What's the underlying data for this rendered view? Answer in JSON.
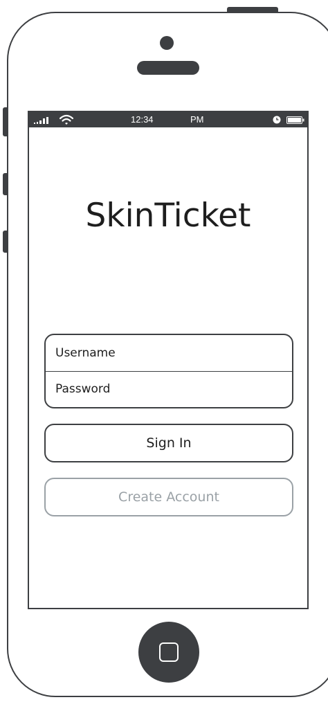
{
  "statusbar": {
    "time": "12:34",
    "ampm": "PM",
    "signal_icon": "signal-bars-icon",
    "wifi_icon": "wifi-icon",
    "clock_icon": "clock-icon",
    "battery_icon": "battery-icon"
  },
  "app": {
    "title": "SkinTicket"
  },
  "login_form": {
    "username_placeholder": "Username",
    "password_placeholder": "Password",
    "username_value": "",
    "password_value": ""
  },
  "buttons": {
    "sign_in": "Sign In",
    "create_account": "Create Account"
  },
  "colors": {
    "device": "#3d3f42",
    "text": "#1e1e1e",
    "disabled": "#9aa1a6",
    "background": "#ffffff"
  }
}
